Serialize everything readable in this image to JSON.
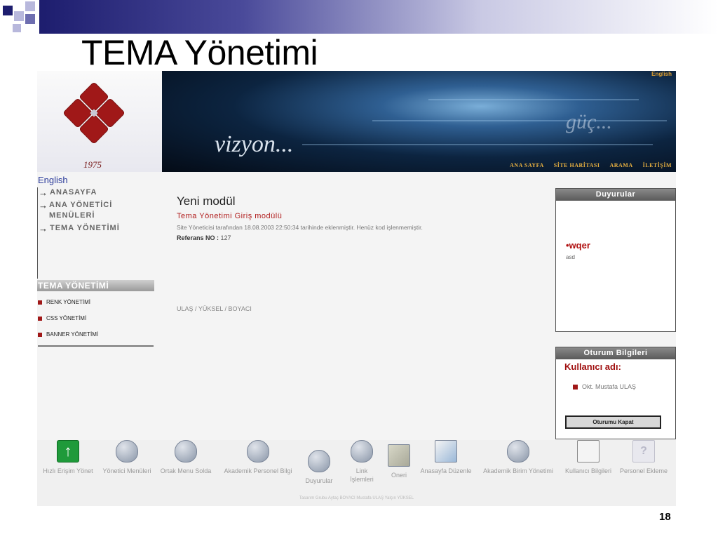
{
  "slide": {
    "title": "TEMA Yönetimi",
    "page_number": "18"
  },
  "header": {
    "logo_year": "1975",
    "banner_text": "vizyon...",
    "banner_slogan": "güç...",
    "english_link": "English",
    "nav": [
      "ANA SAYFA",
      "SİTE HARİTASI",
      "ARAMA",
      "İLETİŞİM"
    ]
  },
  "sidebar": {
    "english_link": "English",
    "items": [
      {
        "label": "ANASAYFA"
      },
      {
        "label": "ANA YÖNETİCİ MENÜLERİ"
      },
      {
        "label": "TEMA YÖNETİMİ"
      }
    ],
    "section_title": "TEMA YÖNETİMİ",
    "sub_items": [
      {
        "label": "RENK YÖNETİMİ"
      },
      {
        "label": "CSS YÖNETİMİ"
      },
      {
        "label": "BANNER YÖNETİMİ"
      }
    ]
  },
  "main": {
    "title": "Yeni modül",
    "subtitle": "Tema Yönetimi Giriş modülü",
    "description": "Site Yöneticisi tarafından 18.08.2003 22:50:34 tarihinde eklenmiştir. Henüz kod işlenmemiştir.",
    "ref_label": "Referans NO :",
    "ref_value": "127",
    "authors": "ULAŞ / YÜKSEL / BOYACI"
  },
  "announcements": {
    "title": "Duyurular",
    "item_title": "•wqer",
    "item_text": "asd"
  },
  "session": {
    "title": "Oturum Bilgileri",
    "user_label": "Kullanıcı adı:",
    "user_name": "Okt. Mustafa ULAŞ",
    "logout_label": "Oturumu Kapat"
  },
  "dock": {
    "items": [
      {
        "label": "Hızlı Erişim Yönet",
        "icon": "up-arrow-icon"
      },
      {
        "label": "Yönetici Menüleri",
        "icon": "folder-icon"
      },
      {
        "label": "Ortak Menu Solda",
        "icon": "folder-tools-icon"
      },
      {
        "label": "Akademik Personel Bilgi",
        "icon": "folder-icon"
      },
      {
        "label": "Duyurular",
        "icon": "folder-icon"
      },
      {
        "label": "Link İşlemleri",
        "icon": "folder-icon"
      },
      {
        "label": "Oneri",
        "icon": "documents-icon"
      },
      {
        "label": "Anasayfa Düzenle",
        "icon": "page-edit-icon"
      },
      {
        "label": "Akademik Birim Yönetimi",
        "icon": "folder-icon"
      },
      {
        "label": "Kullanıcı Bilgileri",
        "icon": "user-info-icon"
      },
      {
        "label": "Personel Ekleme",
        "icon": "help-icon"
      }
    ],
    "credit": "Tasarım Grubu Aytaç BOYACI Mustafa ULAŞ Yalçın YÜKSEL"
  },
  "colors": {
    "accent_red": "#b01c1c",
    "title_bar_dark": "#1d1d6e",
    "panel_header": "#6a6a6a",
    "link_blue": "#2a3a9a"
  }
}
